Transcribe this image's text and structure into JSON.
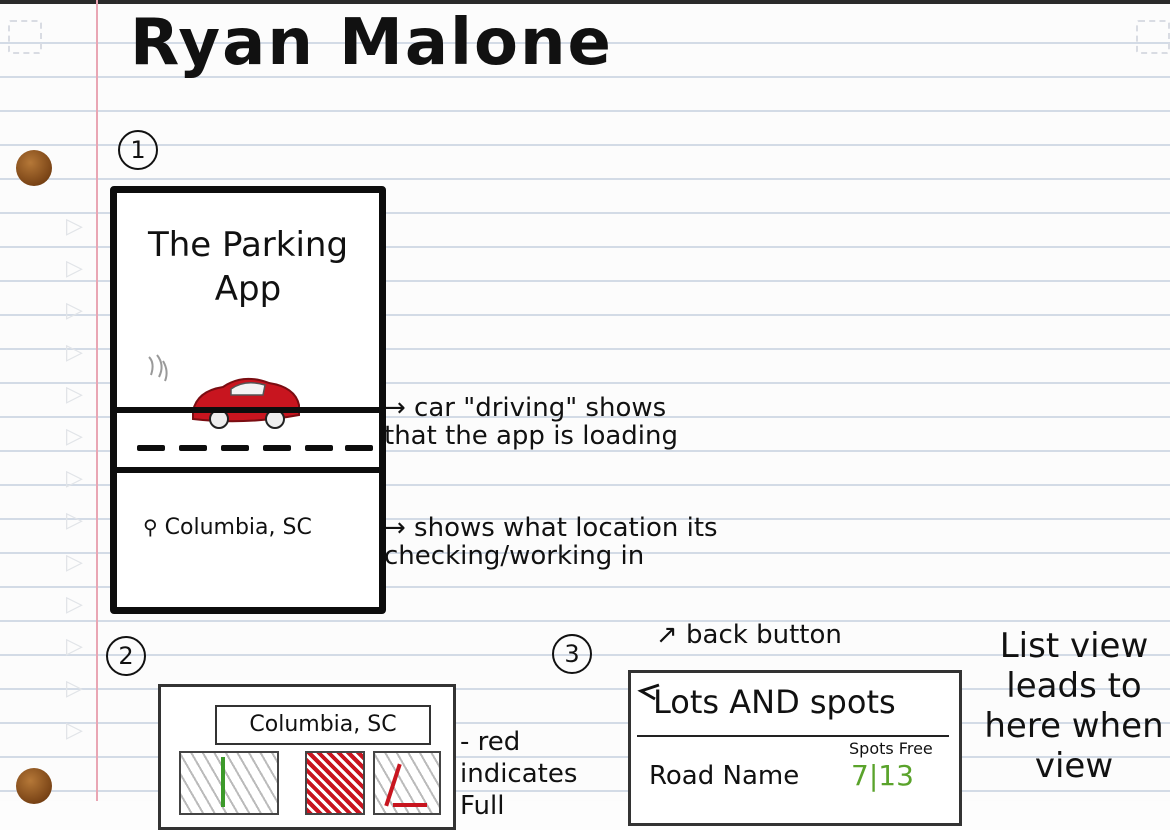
{
  "page": {
    "author_name": "Ryan Malone",
    "colors": {
      "ink": "#111111",
      "car_red": "#c8151f",
      "spots_green": "#5aa32b",
      "full_red": "#c8151f",
      "margin_pink": "#e9a6b4",
      "rule_blue": "#d3dbe6"
    }
  },
  "sketch1": {
    "number": "1",
    "app_title": "The Parking App",
    "location": "Columbia, SC",
    "location_icon": "map-pin-icon",
    "car_icon": "car-icon",
    "annotation_car": "→ car \"driving\" shows that the app is loading",
    "annotation_location": "→ shows what location its checking/working in"
  },
  "sketch2": {
    "number": "2",
    "search_value": "Columbia, SC",
    "annotation_red": "- red indicates Full"
  },
  "sketch3": {
    "number": "3",
    "back_annotation": "↗ back button",
    "screen_title": "Lots AND spots",
    "back_icon": "back-arrow-icon",
    "column_label": "Spots Free",
    "row_name": "Road Name",
    "row_count": "7|13",
    "side_note": "List view leads to here when view"
  }
}
